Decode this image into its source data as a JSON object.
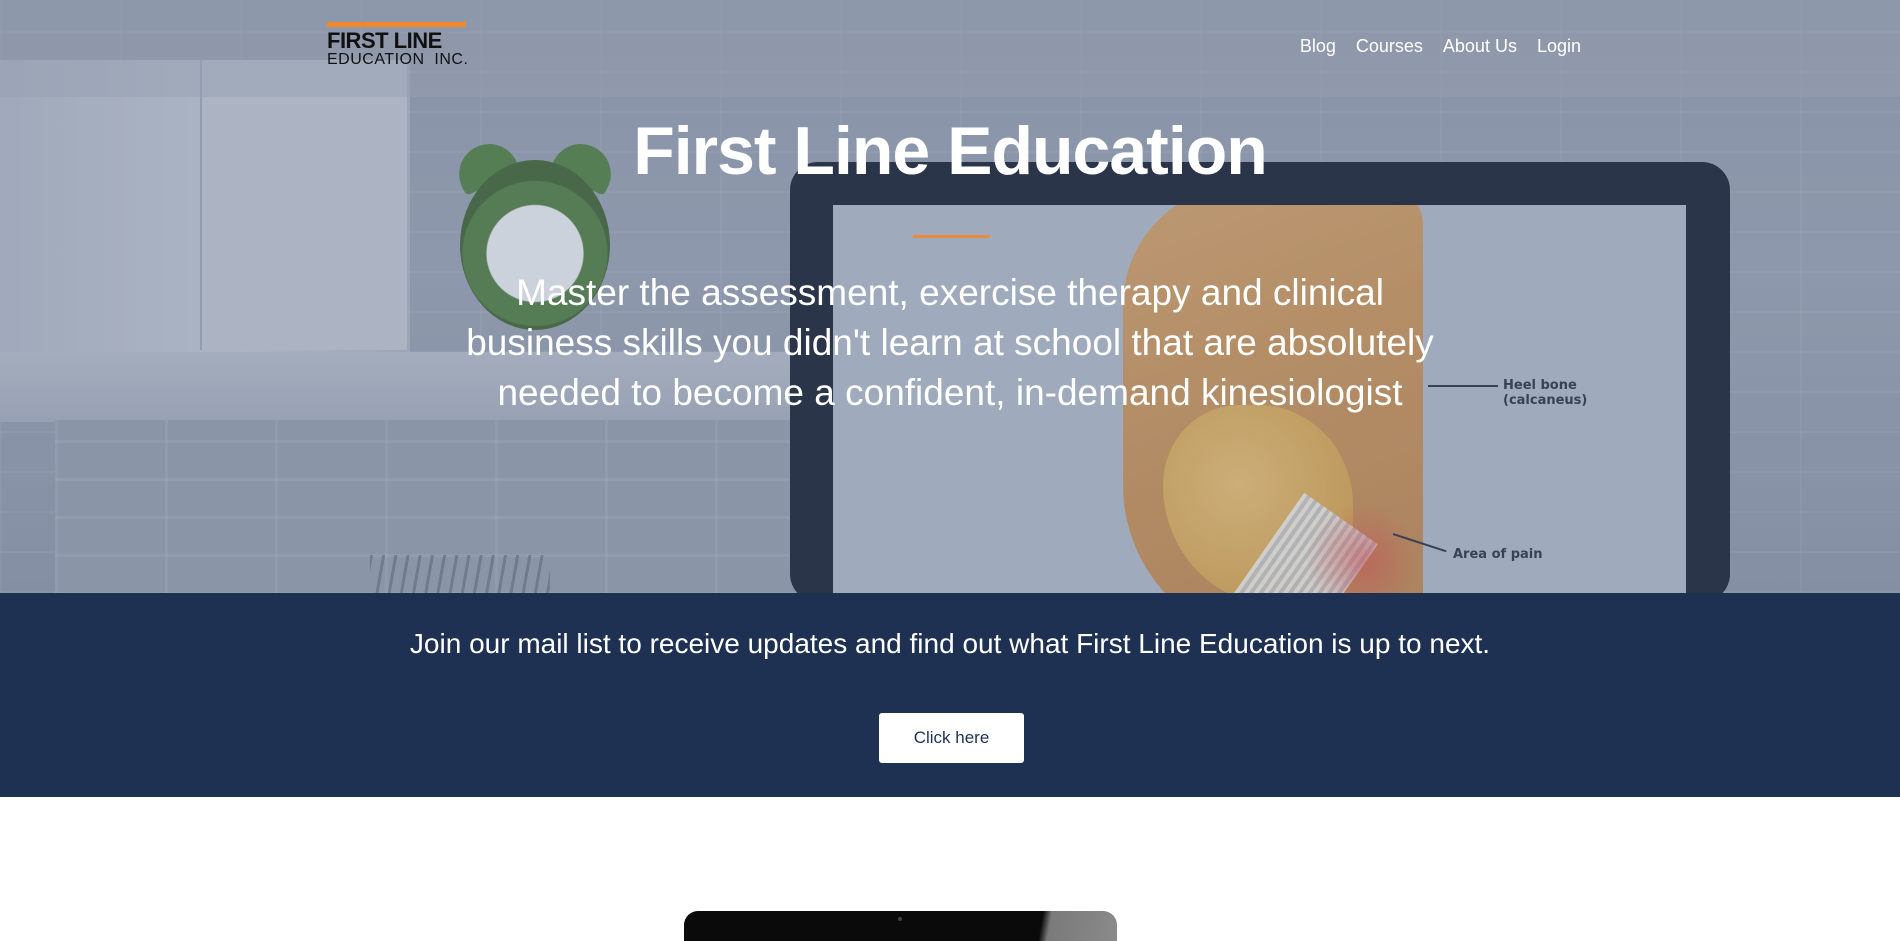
{
  "header": {
    "logo": {
      "line1": "FIRST LINE",
      "line2": "EDUCATION  INC.",
      "accent_color": "#f0872a"
    },
    "nav": [
      "Blog",
      "Courses",
      "About Us",
      "Login"
    ]
  },
  "hero": {
    "title": "First Line Education",
    "subtitle": "Master the assessment, exercise therapy and clinical business skills you didn't learn at school that are absolutely needed to become a confident, in-demand kinesiologist",
    "divider_color": "#e98b3a",
    "image_labels": {
      "heel_bone_line1": "Heel bone",
      "heel_bone_line2": "(calcaneus)",
      "pain": "Area of pain"
    }
  },
  "mail_band": {
    "text": "Join our mail list to receive updates and find out what First Line Education is up to next.",
    "button_label": "Click here",
    "background_color": "#1e3152"
  }
}
